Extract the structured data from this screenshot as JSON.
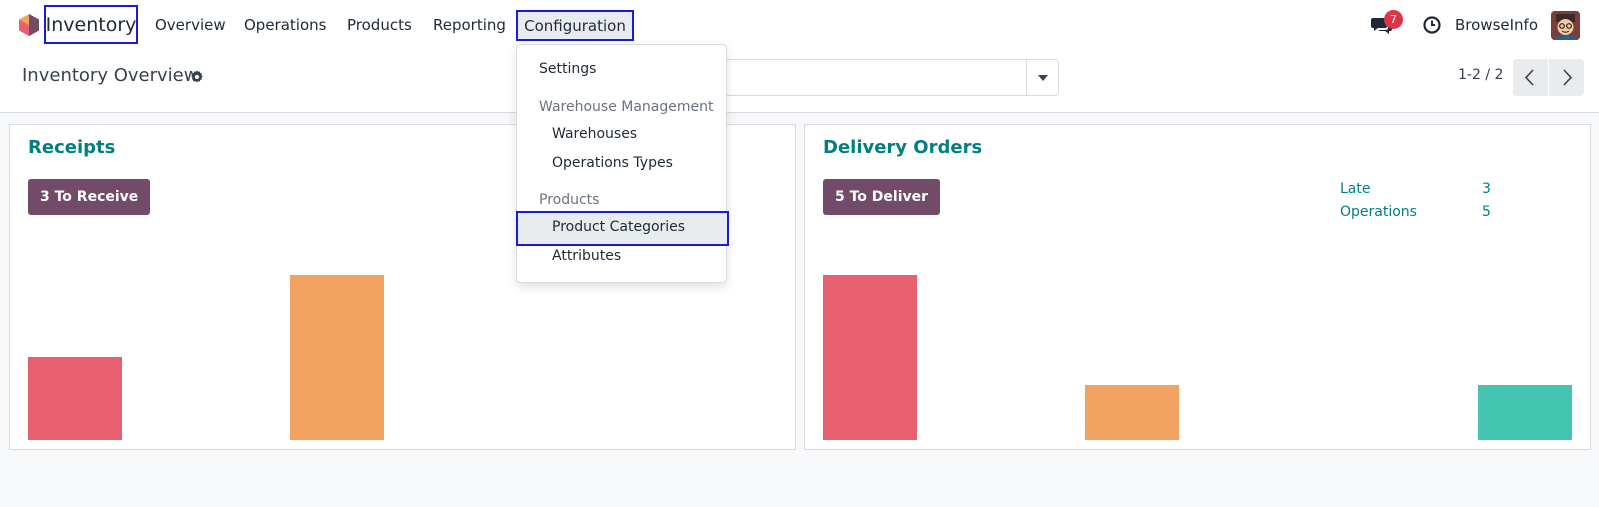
{
  "navbar": {
    "app_name": "Inventory",
    "menu": [
      "Overview",
      "Operations",
      "Products",
      "Reporting"
    ],
    "config_label": "Configuration",
    "messages_badge": "7",
    "company": "BrowseInfo"
  },
  "control": {
    "title": "Inventory Overview",
    "pager": "1-2 / 2"
  },
  "receipts": {
    "title": "Receipts",
    "button": "3 To Receive",
    "bars": [
      {
        "color": "#e8606f",
        "value": 3
      },
      {
        "color": "#f2a361",
        "value": 6
      }
    ]
  },
  "delivery": {
    "title": "Delivery Orders",
    "button": "5 To Deliver",
    "stats": [
      {
        "label": "Late",
        "value": "3"
      },
      {
        "label": "Operations",
        "value": "5"
      }
    ],
    "bars": [
      {
        "color": "#e8606f",
        "value": 3
      },
      {
        "color": "#f2a361",
        "value": 1
      },
      {
        "color": "#43c5b1",
        "value": 1
      }
    ]
  },
  "dropdown": {
    "settings": "Settings",
    "section_warehouse": "Warehouse Management",
    "warehouses": "Warehouses",
    "operation_types": "Operations Types",
    "section_products": "Products",
    "product_categories": "Product Categories",
    "attributes": "Attributes"
  }
}
